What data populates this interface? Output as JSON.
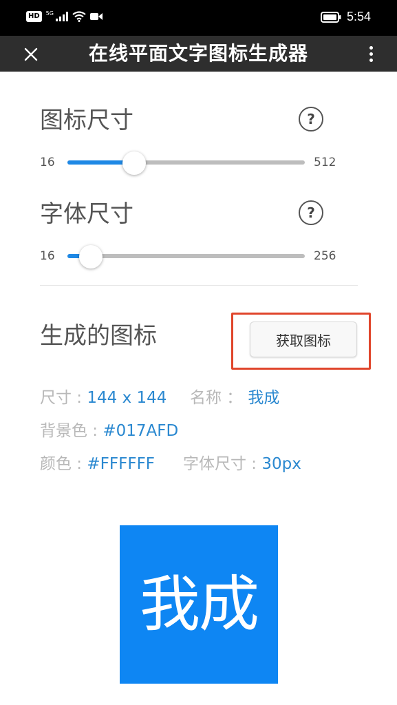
{
  "status_bar": {
    "hd_badge": "HD",
    "signal_label": "5G",
    "time": "5:54"
  },
  "title_bar": {
    "title": "在线平面文字图标生成器",
    "close_icon": "close-icon",
    "menu_icon": "more-vertical-icon"
  },
  "icon_size": {
    "title": "图标尺寸",
    "help": "?",
    "min": "16",
    "max": "512",
    "value": 144
  },
  "font_size": {
    "title": "字体尺寸",
    "help": "?",
    "min": "16",
    "max": "256",
    "value": 30
  },
  "generated": {
    "title": "生成的图标",
    "get_button": "获取图标",
    "size_label": "尺寸 : ",
    "size_value": "144 x 144",
    "name_label": "名称 ：",
    "name_value": "我成",
    "bg_label": "背景色 : ",
    "bg_value": "#017AFD",
    "color_label": "颜色 : ",
    "color_value": "#FFFFFF",
    "fontsize_label": "字体尺寸 : ",
    "fontsize_value": "30px"
  },
  "preview": {
    "text": "我成",
    "background": "#0E86F3",
    "color": "#FFFFFF"
  },
  "colors": {
    "accent": "#1E88E5",
    "highlight_border": "#E0452B"
  }
}
